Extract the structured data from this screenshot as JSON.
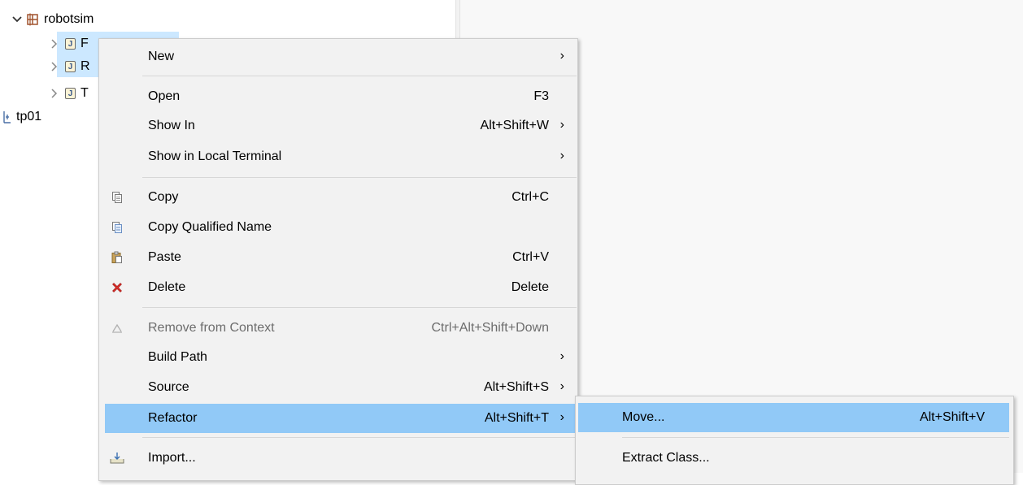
{
  "tree": {
    "project_name": "robotsim",
    "files": [
      {
        "label": "F"
      },
      {
        "label": "R"
      },
      {
        "label": "T"
      }
    ],
    "other_project": "tp01"
  },
  "context_menu": {
    "items": [
      {
        "label": "New",
        "shortcut": "",
        "submenu": true
      },
      {
        "label": "Open",
        "shortcut": "F3",
        "submenu": false
      },
      {
        "label": "Show In",
        "shortcut": "Alt+Shift+W",
        "submenu": true
      },
      {
        "label": "Show in Local Terminal",
        "shortcut": "",
        "submenu": true
      },
      {
        "label": "Copy",
        "shortcut": "Ctrl+C",
        "submenu": false,
        "icon": "copy-icon"
      },
      {
        "label": "Copy Qualified Name",
        "shortcut": "",
        "submenu": false,
        "icon": "copy-qualified-name-icon"
      },
      {
        "label": "Paste",
        "shortcut": "Ctrl+V",
        "submenu": false,
        "icon": "paste-icon"
      },
      {
        "label": "Delete",
        "shortcut": "Delete",
        "submenu": false,
        "icon": "delete-icon"
      },
      {
        "label": "Remove from Context",
        "shortcut": "Ctrl+Alt+Shift+Down",
        "submenu": false,
        "disabled": true,
        "icon": "remove-context-icon"
      },
      {
        "label": "Build Path",
        "shortcut": "",
        "submenu": true
      },
      {
        "label": "Source",
        "shortcut": "Alt+Shift+S",
        "submenu": true
      },
      {
        "label": "Refactor",
        "shortcut": "Alt+Shift+T",
        "submenu": true,
        "highlighted": true
      },
      {
        "label": "Import...",
        "shortcut": "",
        "submenu": false,
        "icon": "import-icon"
      }
    ],
    "arrow_glyph": "›"
  },
  "refactor_submenu": {
    "items": [
      {
        "label": "Move...",
        "shortcut": "Alt+Shift+V",
        "highlighted": true
      },
      {
        "label": "Extract Class...",
        "shortcut": ""
      }
    ]
  },
  "colors": {
    "highlight": "#91c9f7",
    "selection": "#cce8ff",
    "menu_bg": "#f2f2f2",
    "delete_red": "#d9302c"
  }
}
